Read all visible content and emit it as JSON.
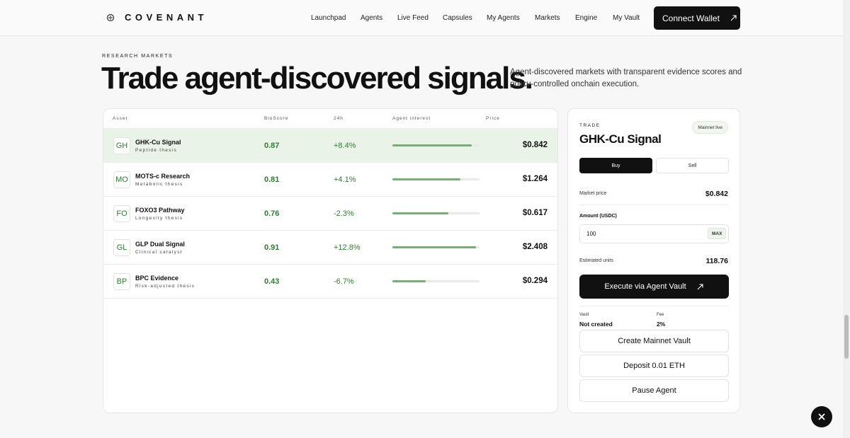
{
  "brand": {
    "name": "COVENANT"
  },
  "nav": {
    "links": [
      "Launchpad",
      "Agents",
      "Live Feed",
      "Capsules",
      "My Agents",
      "Markets",
      "Engine",
      "My Vault"
    ],
    "connect_label": "Connect Wallet"
  },
  "hero": {
    "eyebrow": "RESEARCH MARKETS",
    "headline": "Trade agent-discovered signals.",
    "lede": "Agent-discovered markets with transparent evidence scores and policy-controlled onchain execution."
  },
  "table": {
    "headers": {
      "asset": "Asset",
      "bioscore": "BioScore",
      "change": "24h",
      "interest": "Agent interest",
      "price": "Price"
    },
    "rows": [
      {
        "code": "GH",
        "name": "GHK-Cu Signal",
        "sub": "Peptide thesis",
        "bioscore": "0.87",
        "change": "+8.4%",
        "interest": 0.91,
        "price": "$0.842",
        "selected": true
      },
      {
        "code": "MO",
        "name": "MOTS-c Research",
        "sub": "Metabolic thesis",
        "bioscore": "0.81",
        "change": "+4.1%",
        "interest": 0.78,
        "price": "$1.264",
        "selected": false
      },
      {
        "code": "FO",
        "name": "FOXO3 Pathway",
        "sub": "Longevity thesis",
        "bioscore": "0.76",
        "change": "-2.3%",
        "interest": 0.64,
        "price": "$0.617",
        "selected": false
      },
      {
        "code": "GL",
        "name": "GLP Dual Signal",
        "sub": "Clinical catalyst",
        "bioscore": "0.91",
        "change": "+12.8%",
        "interest": 0.96,
        "price": "$2.408",
        "selected": false
      },
      {
        "code": "BP",
        "name": "BPC Evidence",
        "sub": "Risk-adjusted thesis",
        "bioscore": "0.43",
        "change": "-6.7%",
        "interest": 0.38,
        "price": "$0.294",
        "selected": false
      }
    ]
  },
  "trade": {
    "eyebrow": "TRADE",
    "badge": "Mainnet live",
    "title": "GHK-Cu Signal",
    "buy_label": "Buy",
    "sell_label": "Sell",
    "market_price_label": "Market price",
    "market_price": "$0.842",
    "amount_label": "Amount (USDC)",
    "amount_value": "100",
    "max_label": "MAX",
    "units_label": "Estimated units",
    "units_value": "118.76",
    "execute_label": "Execute via Agent Vault",
    "vault_label": "Vault",
    "vault_value": "Not created",
    "fee_label": "Fee",
    "fee_value": "2%",
    "create_vault_label": "Create Mainnet Vault",
    "deposit_label": "Deposit 0.01 ETH",
    "pause_label": "Pause Agent"
  },
  "colors": {
    "accent_green": "#2e7d32",
    "bar_fill": "#7aab79",
    "selected_row": "#eaf3e8",
    "dark": "#111111"
  }
}
